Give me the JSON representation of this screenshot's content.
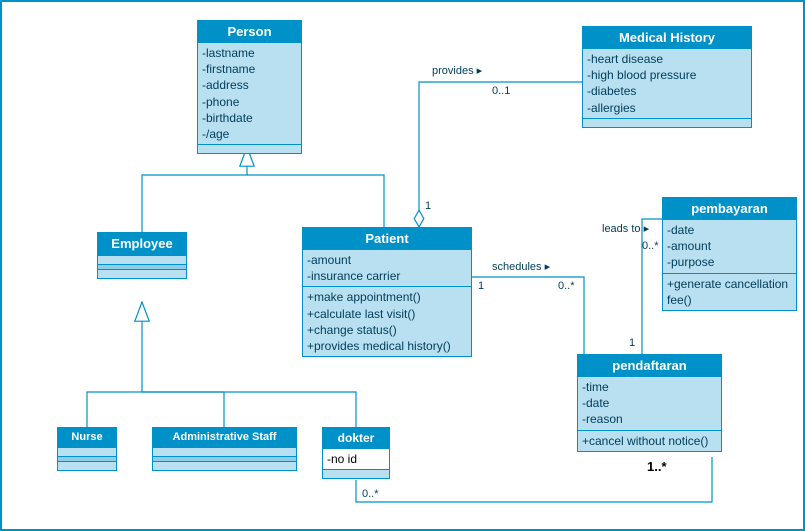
{
  "colors": {
    "border": "#0091c9",
    "fill": "#b8e0f0",
    "text": "#003c5a"
  },
  "classes": {
    "person": {
      "title": "Person",
      "attrs": [
        "-lastname",
        "-firstname",
        "-address",
        "-phone",
        "-birthdate",
        "-/age"
      ]
    },
    "medical_history": {
      "title": "Medical History",
      "attrs": [
        "-heart disease",
        "-high blood pressure",
        "-diabetes",
        "-allergies"
      ]
    },
    "employee": {
      "title": "Employee"
    },
    "patient": {
      "title": "Patient",
      "attrs": [
        "-amount",
        "-insurance carrier"
      ],
      "ops": [
        "+make appointment()",
        "+calculate last visit()",
        "+change status()",
        "+provides medical history()"
      ]
    },
    "pembayaran": {
      "title": "pembayaran",
      "attrs": [
        "-date",
        "-amount",
        "-purpose"
      ],
      "ops": [
        "+generate cancellation fee()"
      ]
    },
    "pendaftaran": {
      "title": "pendaftaran",
      "attrs": [
        "-time",
        "-date",
        "-reason"
      ],
      "ops": [
        "+cancel without notice()"
      ]
    },
    "nurse": {
      "title": "Nurse"
    },
    "admin_staff": {
      "title": "Administrative Staff"
    },
    "dokter": {
      "title": "dokter",
      "attrs": [
        "-no id"
      ]
    }
  },
  "relations": {
    "provides": {
      "label": "provides ▸",
      "mult_near": "0..1",
      "mult_far": "1"
    },
    "schedules": {
      "label": "schedules ▸",
      "mult_left": "1",
      "mult_right": "0..*"
    },
    "leads_to": {
      "label": "leads to ▸",
      "mult_top": "0..*",
      "mult_bottom": "1"
    },
    "dokter_pendaftaran": {
      "mult_left": "0..*",
      "mult_right": "1..*"
    }
  }
}
